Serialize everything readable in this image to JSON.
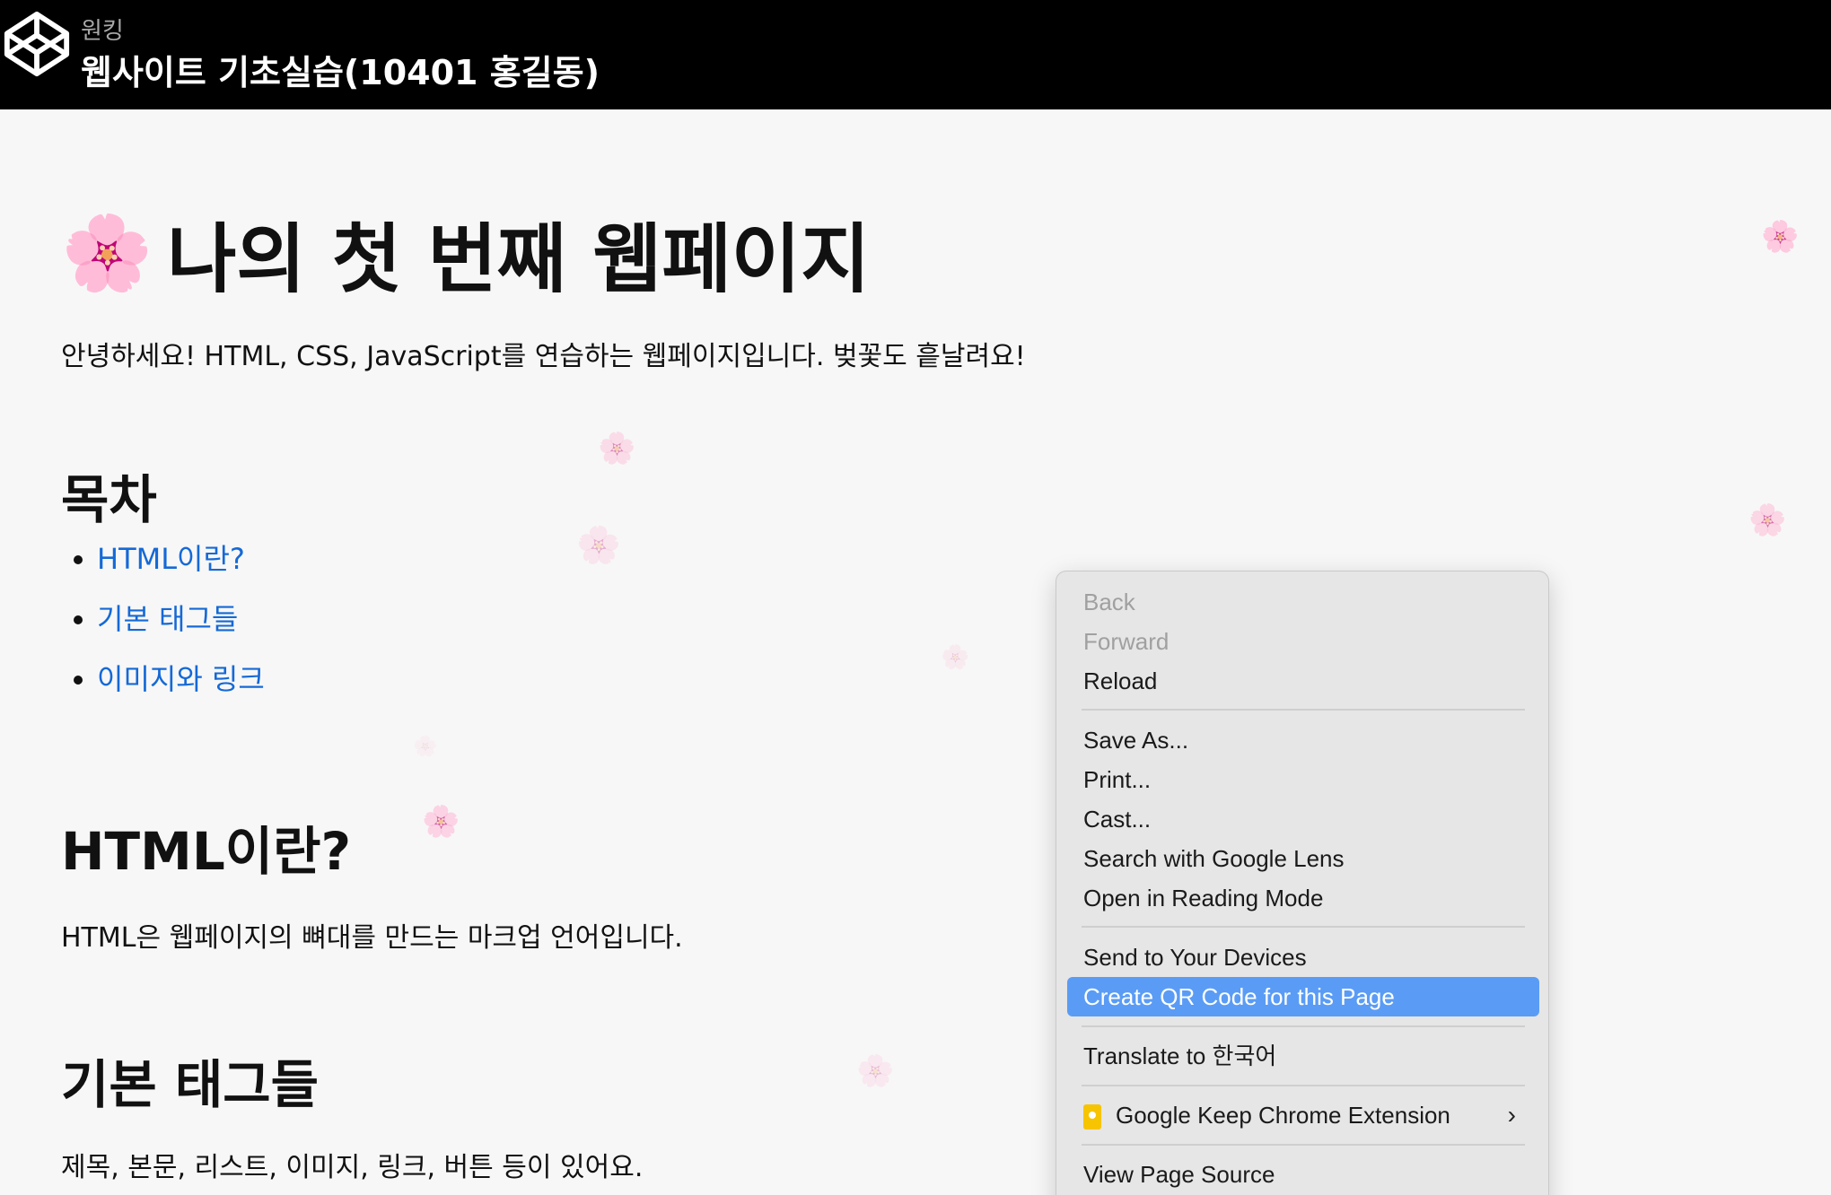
{
  "header": {
    "subtitle": "원킹",
    "title": "웹사이트 기초실습(10401 홍길동)"
  },
  "page": {
    "heading_icon": "🌸",
    "heading": "나의 첫 번째 웹페이지",
    "intro": "안녕하세요! HTML, CSS, JavaScript를 연습하는 웹페이지입니다. 벚꽃도 흩날려요!",
    "toc_title": "목차",
    "toc": [
      "HTML이란?",
      "기본 태그들",
      "이미지와 링크"
    ],
    "section_html_title": "HTML이란?",
    "section_html_text": "HTML은 웹페이지의 뼈대를 만드는 마크업 언어입니다.",
    "section_tags_title": "기본 태그들",
    "section_tags_text": "제목, 본문, 리스트, 이미지, 링크, 버튼 등이 있어요."
  },
  "petals": [
    "🌸",
    "🌸",
    "🌸",
    "🌸",
    "🌸",
    "🌸",
    "🌸",
    "🌸"
  ],
  "context_menu": {
    "back": "Back",
    "forward": "Forward",
    "reload": "Reload",
    "save_as": "Save As...",
    "print": "Print...",
    "cast": "Cast...",
    "lens": "Search with Google Lens",
    "reading_mode": "Open in Reading Mode",
    "send_devices": "Send to Your Devices",
    "qr_code": "Create QR Code for this Page",
    "translate": "Translate to 한국어",
    "keep": "Google Keep Chrome Extension",
    "keep_arrow": "›",
    "view_source": "View Page Source"
  },
  "colors": {
    "link": "#1569d6",
    "menu_highlight": "#5a9cf5",
    "header_bg": "#000000"
  }
}
